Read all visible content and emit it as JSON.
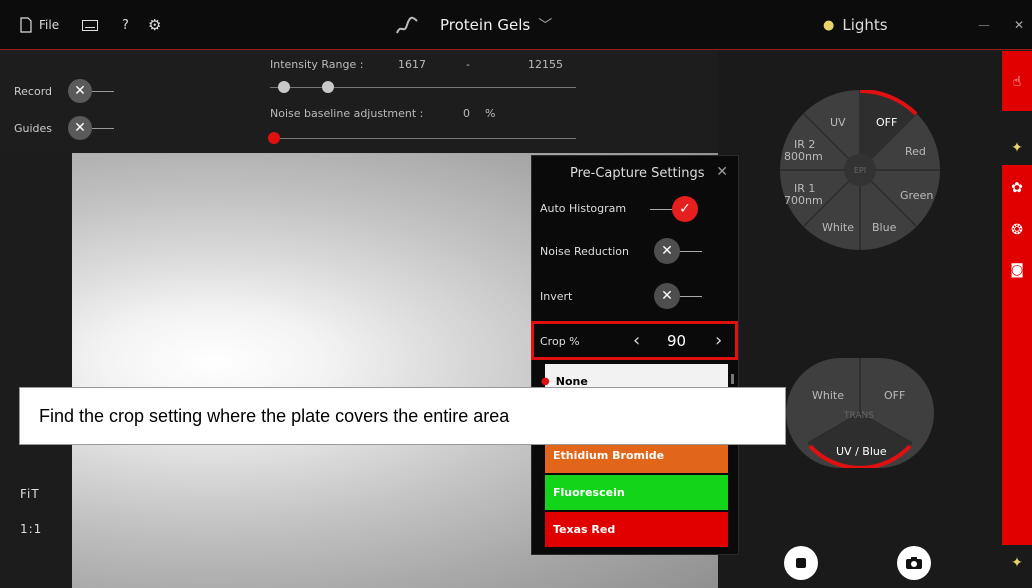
{
  "titlebar": {
    "file_label": "File",
    "help_label": "?",
    "title": "Protein Gels",
    "lights_label": "Lights",
    "minimize_label": "—",
    "close_label": "✕"
  },
  "controls": {
    "record_label": "Record",
    "guides_label": "Guides",
    "intensity_label": "Intensity Range :",
    "intensity_min": "1617",
    "intensity_sep": "-",
    "intensity_max": "12155",
    "noise_label": "Noise baseline adjustment :",
    "noise_value": "0",
    "noise_unit": "%"
  },
  "side_buttons": {
    "fit_label": "FiT",
    "one_to_one_label": "1:1"
  },
  "dialog": {
    "title": "Pre-Capture Settings",
    "auto_histogram_label": "Auto Histogram",
    "noise_reduction_label": "Noise Reduction",
    "invert_label": "Invert",
    "crop_label": "Crop %",
    "crop_value": "90",
    "dyes": [
      {
        "label": "None",
        "color": "#f2f2f2"
      },
      {
        "label": "Ethidium Bromide",
        "color": "#e2661a"
      },
      {
        "label": "Fluorescein",
        "color": "#14d41a"
      },
      {
        "label": "Texas Red",
        "color": "#e00000"
      }
    ]
  },
  "epi_wheel": {
    "uv": "UV",
    "off": "OFF",
    "ir2": "IR 2",
    "ir2_nm": "800nm",
    "epi": "EPI",
    "red": "Red",
    "ir1": "IR 1",
    "ir1_nm": "700nm",
    "green": "Green",
    "white": "White",
    "blue": "Blue"
  },
  "trans_wheel": {
    "white": "White",
    "off": "OFF",
    "trans": "TRANS",
    "uv_blue": "UV / Blue"
  },
  "instruction": "Find the crop setting where the plate covers the entire area",
  "colors": {
    "accent": "#e01010",
    "titlebar": "#0c0c0c"
  }
}
